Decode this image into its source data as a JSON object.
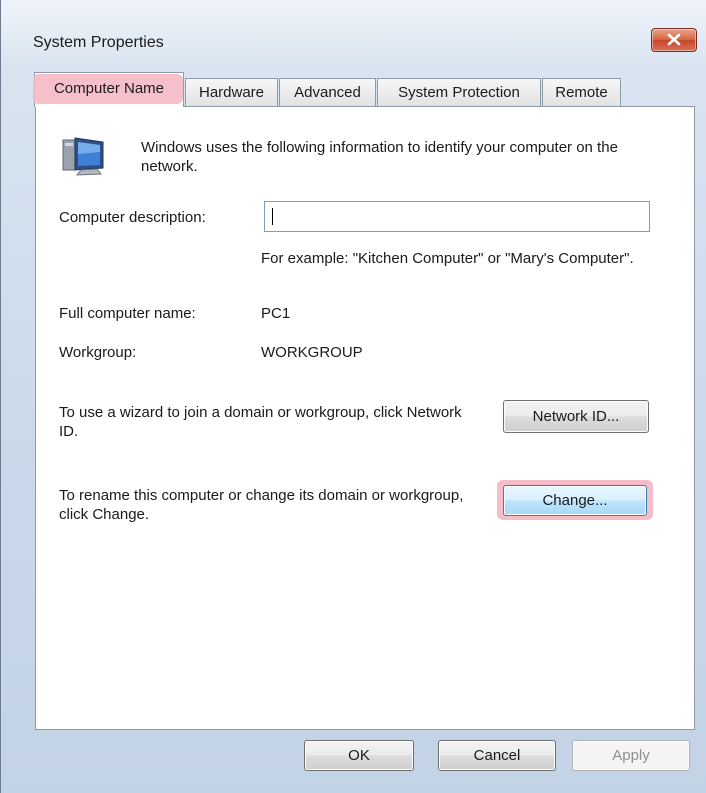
{
  "window": {
    "title": "System Properties"
  },
  "tabs": [
    {
      "label": "Computer Name"
    },
    {
      "label": "Hardware"
    },
    {
      "label": "Advanced"
    },
    {
      "label": "System Protection"
    },
    {
      "label": "Remote"
    }
  ],
  "panel": {
    "intro": "Windows uses the following information to identify your computer on the network.",
    "description_label": "Computer description:",
    "description_value": "",
    "description_example": "For example: \"Kitchen Computer\" or \"Mary's Computer\".",
    "full_name_label": "Full computer name:",
    "full_name_value": "PC1",
    "workgroup_label": "Workgroup:",
    "workgroup_value": "WORKGROUP",
    "network_id_text": "To use a wizard to join a domain or workgroup, click Network ID.",
    "network_id_button": "Network ID...",
    "change_text": "To rename this computer or change its domain or workgroup, click Change.",
    "change_button": "Change..."
  },
  "footer": {
    "ok": "OK",
    "cancel": "Cancel",
    "apply": "Apply"
  },
  "icons": {
    "computer": "computer-monitor-icon",
    "close": "close-icon"
  }
}
